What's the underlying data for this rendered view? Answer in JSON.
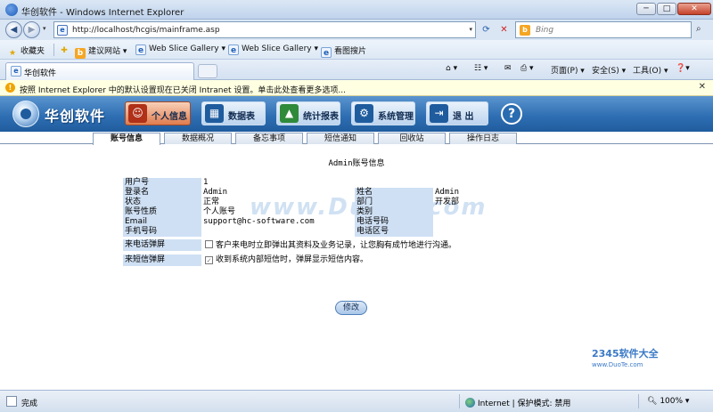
{
  "window": {
    "title": "华创软件 - Windows Internet Explorer",
    "min": "─",
    "max": "□",
    "close": "✕"
  },
  "address": {
    "url": "http://localhost/hcgis/mainframe.asp",
    "search_placeholder": "Bing"
  },
  "favorites": {
    "label": "收藏夹",
    "items": [
      "建议网站 ▾",
      "Web Slice Gallery ▾",
      "Web Slice Gallery ▾",
      "看图搜片"
    ]
  },
  "tabs": {
    "active_tab": "华创软件"
  },
  "commandbar": {
    "page": "页面(P) ▾",
    "safety": "安全(S) ▾",
    "tools": "工具(O) ▾",
    "help": "❓▾"
  },
  "infobar": {
    "message": "按照 Internet Explorer 中的默认设置现在已关闭 Intranet 设置。单击此处查看更多选项..."
  },
  "app": {
    "brand": "华创软件",
    "nav": [
      {
        "label": "个人信息",
        "icon": "person-icon",
        "color": "#b03018"
      },
      {
        "label": "数据表",
        "icon": "table-icon",
        "color": "#1f5c9e"
      },
      {
        "label": "统计报表",
        "icon": "chart-icon",
        "color": "#2f8a3a"
      },
      {
        "label": "系统管理",
        "icon": "gear-icon",
        "color": "#1f5c9e"
      },
      {
        "label": "退  出",
        "icon": "exit-icon",
        "color": "#1f5c9e"
      }
    ],
    "help": "?",
    "subtabs": [
      "账号信息",
      "数据概况",
      "备忘事项",
      "短信通知",
      "回收站",
      "操作日志"
    ],
    "active_subtab": 0
  },
  "account": {
    "title": "Admin账号信息",
    "left": [
      {
        "label": "用户号",
        "value": "1"
      },
      {
        "label": "登录名",
        "value": "Admin"
      },
      {
        "label": "状态",
        "value": "正常"
      },
      {
        "label": "账号性质",
        "value": "个人账号"
      },
      {
        "label": "Email",
        "value": "support@hc-software.com"
      },
      {
        "label": "手机号码",
        "value": ""
      }
    ],
    "right": [
      {
        "label": "姓名",
        "value": "Admin"
      },
      {
        "label": "部门",
        "value": "开发部"
      },
      {
        "label": "类别",
        "value": ""
      },
      {
        "label": "电话号码",
        "value": ""
      },
      {
        "label": "电话区号",
        "value": ""
      }
    ],
    "popup_call_label": "来电话弹屏",
    "popup_call_text": "客户来电时立即弹出其资料及业务记录，让您胸有成竹地进行沟通。",
    "popup_call_checked": false,
    "popup_sms_label": "来短信弹屏",
    "popup_sms_text": "收到系统内部短信时，弹屏显示短信内容。",
    "popup_sms_checked": true,
    "edit_button": "修改"
  },
  "watermark": "www.DuoTe.com",
  "corner": {
    "brand": "2345软件大全",
    "url": "www.DuoTe.com"
  },
  "status": {
    "text": "完成",
    "zone": "Internet | 保护模式: 禁用",
    "zoom": "100%"
  }
}
